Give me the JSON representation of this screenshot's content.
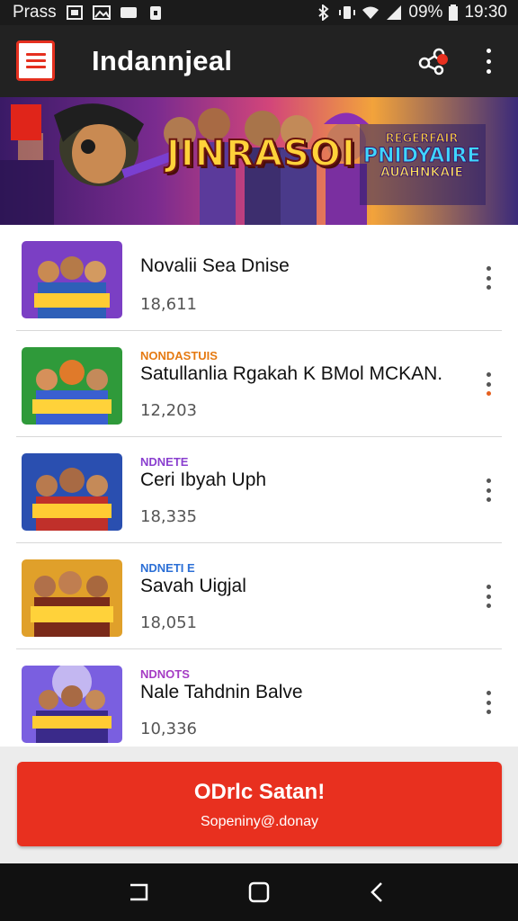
{
  "status_bar": {
    "carrier": "Prass",
    "battery": "09%",
    "time": "19:30"
  },
  "app_bar": {
    "title": "Indannjeal",
    "menu_icon": "hamburger-menu-icon",
    "share_icon": "share-icon",
    "more_icon": "more-vertical-icon"
  },
  "banner": {
    "title": "JINRASOI",
    "badge_line1": "REGERFAIR",
    "badge_line2": "PNIDYAIRE",
    "badge_line3": "AUAHNKAIE"
  },
  "list": {
    "items": [
      {
        "tag": "",
        "title": "Novalii Sea Dnise",
        "count": "18,611",
        "tag_color": "#e57a12"
      },
      {
        "tag": "NONDASTUIS",
        "title": "Satullanlia Rgakah K BMol MCKAN.",
        "count": "12,203",
        "tag_color": "#e57a12"
      },
      {
        "tag": "NDNETE",
        "title": "Ceri Ibyah Uph",
        "count": "18,335",
        "tag_color": "#8a3fcf"
      },
      {
        "tag": "NDNETI E",
        "title": "Savah Uigjal",
        "count": "18,051",
        "tag_color": "#2b6fd6"
      },
      {
        "tag": "NDNOTS",
        "title": "Nale Tahdnin Balve",
        "count": "10,336",
        "tag_color": "#a53cc4"
      }
    ]
  },
  "cta": {
    "title": "ODrlc Satan!",
    "subtitle": "Sopeniny@.donay"
  },
  "colors": {
    "accent": "#e8301f",
    "app_bar": "#222222"
  }
}
